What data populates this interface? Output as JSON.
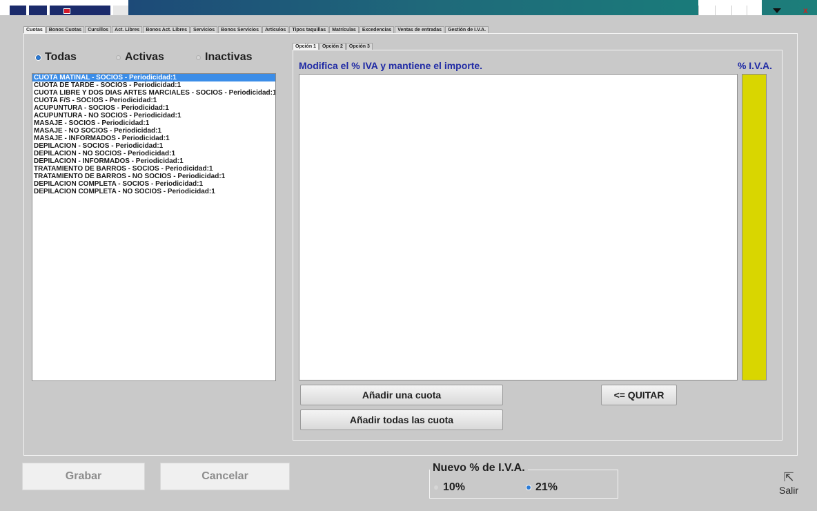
{
  "tabs": [
    "Cuotas",
    "Bonos Cuotas",
    "Cursillos",
    "Act. Libres",
    "Bonos Act. Libres",
    "Servicios",
    "Bonos Servicios",
    "Artículos",
    "Tipos taquillas",
    "Matrículas",
    "Excedencias",
    "Ventas de entradas",
    "Gestión de I.V.A."
  ],
  "filter": {
    "todas": "Todas",
    "activas": "Activas",
    "inactivas": "Inactivas"
  },
  "cuotas": [
    "CUOTA MATINAL - SOCIOS - Periodicidad:1",
    "CUOTA DE TARDE - SOCIOS - Periodicidad:1",
    "CUOTA LIBRE Y DOS DIAS ARTES MARCIALES - SOCIOS - Periodicidad:1",
    "CUOTA F/S - SOCIOS - Periodicidad:1",
    "ACUPUNTURA - SOCIOS - Periodicidad:1",
    "ACUPUNTURA - NO SOCIOS - Periodicidad:1",
    "MASAJE - SOCIOS - Periodicidad:1",
    "MASAJE - NO SOCIOS - Periodicidad:1",
    "MASAJE - INFORMADOS - Periodicidad:1",
    "DEPILACION - SOCIOS - Periodicidad:1",
    "DEPILACION - NO SOCIOS - Periodicidad:1",
    "DEPILACION - INFORMADOS - Periodicidad:1",
    "TRATAMIENTO DE BARROS - SOCIOS - Periodicidad:1",
    "TRATAMIENTO DE BARROS - NO SOCIOS - Periodicidad:1",
    "DEPILACION COMPLETA - SOCIOS - Periodicidad:1",
    "DEPILACION COMPLETA - NO SOCIOS - Periodicidad:1"
  ],
  "inner_tabs": [
    "Opción 1",
    "Opción 2",
    "Opción 3"
  ],
  "right": {
    "title": "Modifica el % IVA y mantiene el importe.",
    "iva_header": "% I.V.A.",
    "add_one": "Añadir una cuota",
    "add_all": "Añadir todas las cuota",
    "quitar": "<= QUITAR"
  },
  "bottom": {
    "grabar": "Grabar",
    "cancelar": "Cancelar",
    "iva_legend": "Nuevo % de I.V.A.",
    "opt_10": "10%",
    "opt_21": "21%",
    "salir": "Salir"
  }
}
